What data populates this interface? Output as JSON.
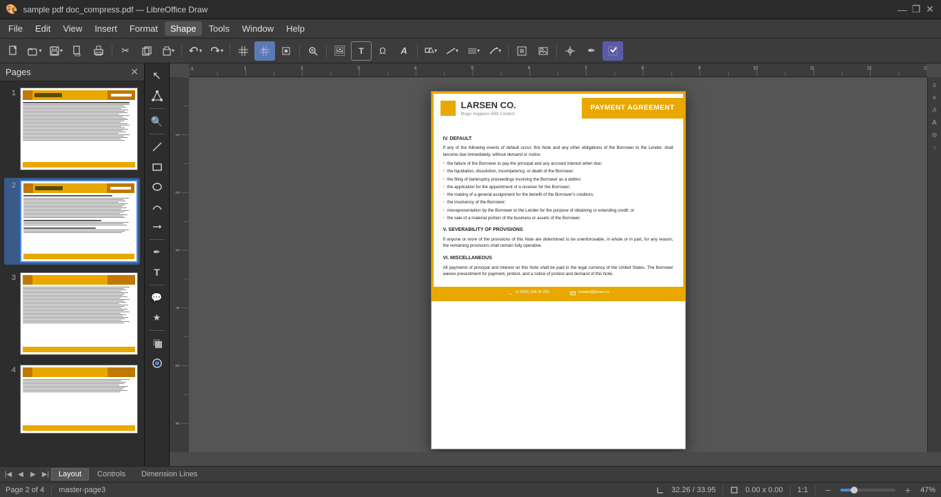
{
  "titleBar": {
    "title": "sample pdf doc_compress.pdf — LibreOffice Draw",
    "minimize": "—",
    "maximize": "❐",
    "close": "✕"
  },
  "menuBar": {
    "items": [
      "File",
      "Edit",
      "View",
      "Insert",
      "Format",
      "Shape",
      "Tools",
      "Window",
      "Help"
    ]
  },
  "toolbar": {
    "buttons": [
      {
        "name": "new",
        "icon": "📄"
      },
      {
        "name": "open",
        "icon": "📂"
      },
      {
        "name": "save",
        "icon": "💾"
      },
      {
        "name": "export-pdf",
        "icon": "📋"
      },
      {
        "name": "print",
        "icon": "🖨"
      },
      {
        "name": "cut",
        "icon": "✂"
      },
      {
        "name": "copy",
        "icon": "📋"
      },
      {
        "name": "paste",
        "icon": "📌"
      },
      {
        "name": "undo",
        "icon": "↩"
      },
      {
        "name": "redo",
        "icon": "↪"
      },
      {
        "name": "grid",
        "icon": "⊞"
      },
      {
        "name": "snap",
        "icon": "⊡"
      },
      {
        "name": "frame",
        "icon": "▣"
      },
      {
        "name": "zoom",
        "icon": "🔍"
      },
      {
        "name": "image",
        "icon": "🖼"
      },
      {
        "name": "textbox",
        "icon": "T"
      },
      {
        "name": "special-char",
        "icon": "Ω"
      },
      {
        "name": "fontwork",
        "icon": "A"
      },
      {
        "name": "shapes",
        "icon": "◻"
      },
      {
        "name": "lines",
        "icon": "╱"
      },
      {
        "name": "more",
        "icon": "…"
      },
      {
        "name": "toggle",
        "icon": "⬛"
      }
    ]
  },
  "pagesPanel": {
    "title": "Pages",
    "pages": [
      {
        "num": "1"
      },
      {
        "num": "2"
      },
      {
        "num": "3"
      },
      {
        "num": "4"
      }
    ]
  },
  "document": {
    "company": "LARSEN CO.",
    "tagline": "Magic Happens With Content",
    "title": "PAYMENT AGREEMENT",
    "section4_title": "IV. DEFAULT",
    "section4_intro": "If any of the following events of default occur, this Note and any other obligations of the Borrower to the Lender, shall become due immediately, without demand or notice:",
    "bullets": [
      "the failure of the Borrower to pay the principal and any accrued interest when due;",
      "the liquidation, dissolution, incompetency, or death of the Borrower;",
      "the filing of bankruptcy proceedings involving the Borrower as a debtor;",
      "the application for the appointment of a receiver for the Borrower;",
      "the making of a general assignment for the benefit of the Borrower's creditors;",
      "the insolvency of the Borrower;",
      "misrepresentation by the Borrower to the Lender for the purpose of obtaining or extending credit; or",
      "the sale of a material portion of the business or assets of the Borrower."
    ],
    "section5_title": "V. SEVERABILITY OF PROVISIONS",
    "section5_text": "If anyone or more of the provisions of this Note are determined to be unenforceable, in whole or in part, for any reason, the remaining provisions shall remain fully operative.",
    "section6_title": "VI. MISCELLANEOUS",
    "section6_text": "All payments of principal and interest on this Note shall be paid in the legal currency of the United States. The Borrower waives presentment for payment, protest, and a notice of protest and demand of this Note.",
    "footer_phone": "+1 (555) 134-34 222",
    "footer_email": "contact@larsen.co"
  },
  "leftToolbar": {
    "tools": [
      {
        "name": "select",
        "icon": "↖"
      },
      {
        "name": "point-edit",
        "icon": "◈"
      },
      {
        "name": "zoom-tool",
        "icon": "🔍"
      },
      {
        "name": "line",
        "icon": "╲"
      },
      {
        "name": "rectangle",
        "icon": "▭"
      },
      {
        "name": "ellipse",
        "icon": "○"
      },
      {
        "name": "curve",
        "icon": "⌒"
      },
      {
        "name": "connector",
        "icon": "⌐"
      },
      {
        "name": "pen",
        "icon": "✒"
      },
      {
        "name": "text",
        "icon": "T"
      },
      {
        "name": "callout",
        "icon": "💬"
      },
      {
        "name": "star",
        "icon": "★"
      },
      {
        "name": "shadow",
        "icon": "▪"
      },
      {
        "name": "color-fill",
        "icon": "◉"
      }
    ]
  },
  "rightPanel": {
    "icons": [
      "≡",
      "≡",
      "A",
      "A",
      "⊕",
      "○"
    ]
  },
  "bottomBar": {
    "page_info": "Page 2 of 4",
    "master": "master-page3",
    "coords": "32.26 / 33.95",
    "size": "0.00 x 0.00",
    "ratio": "1:1",
    "zoom": "47%",
    "tabs": [
      "Layout",
      "Controls",
      "Dimension Lines"
    ]
  },
  "colors": {
    "accent": "#e8a800",
    "selected_page_border": "#4a8adf",
    "toolbar_bg": "#3c3c3c",
    "panel_bg": "#2d2d2d"
  }
}
